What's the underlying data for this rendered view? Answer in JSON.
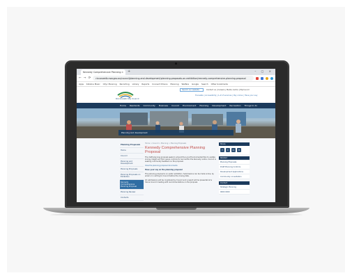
{
  "browser": {
    "tab_title": "Kennedy Comprehensive Planning...",
    "tab_close": "×",
    "new_tab": "+",
    "window_controls": "– ▢ ×",
    "back": "←",
    "forward": "→",
    "reload": "⟳",
    "url": "ricconwelb.nsw.gov.au/council/planning-and-development/planning-proposals-on-exhibition/rennedy-comprehensive-planning-proposal",
    "bookmarks": [
      "Apps",
      "Kidsline Music",
      "Cityc Planning",
      "Recording",
      "Library",
      "Reports",
      "Connect Dmons",
      "Planning",
      "Welfare",
      "Google",
      "Search",
      "Other bookmarks"
    ]
  },
  "site": {
    "logo_text": "Ricconwelb City Council",
    "search_placeholder": "Search our website",
    "top_links": "Contact us | Careers | Media centre | MyCouncil",
    "utility_links": "Translate | Accessibility | A–Z of services | Pay online | Have your say",
    "nav": [
      "Home",
      "Residents",
      "Community",
      "Business",
      "Council",
      "Environment",
      "Planning",
      "Development",
      "Recreation",
      "Things to do"
    ],
    "hero_caption": "Planning and development"
  },
  "leftnav": {
    "heading": "Planning Proposals",
    "items": [
      "Home",
      "Council",
      "Planning and Development",
      "Planning Proposals",
      "Planning Proposals on Exhibition",
      "Kennedy Comprehensive Planning Proposal",
      "Planning Review",
      "Contacts"
    ],
    "active_index": 5
  },
  "main": {
    "breadcrumb": "Home > Council > Planning > Planning Proposals",
    "title": "Kennedy Comprehensive Planning Proposal",
    "para1": "The draft planning proposal seeks to amend the Local Environmental Plan to update zoning, height and floor space controls for land within the Kennedy centre. Council is seeking community feedback on the proposal.",
    "para1_link": "View the planning proposal documents",
    "subhead": "Have your say on the planning proposal",
    "para2": "The planning proposal is on public exhibition. Submissions can be made online, by email or in writing to Council before the closing date.",
    "para3": "All submissions will be considered by Council and a report will be presented at a future Council meeting with recommendations on the proposal."
  },
  "rightcol": {
    "share_heading": "Share",
    "social": [
      "f",
      "t",
      "in",
      "✉"
    ],
    "related_heading": "Related",
    "related": [
      "Planning Proposals",
      "Draft Planning Controls",
      "Development Applications",
      "Community consultation"
    ],
    "contact_heading": "Contact",
    "contact_lines": [
      "Strategic Planning",
      "9000 0000"
    ]
  },
  "colors": {
    "nav_bg": "#1b3a5c",
    "title": "#c0504d",
    "link": "#2f6da3"
  }
}
